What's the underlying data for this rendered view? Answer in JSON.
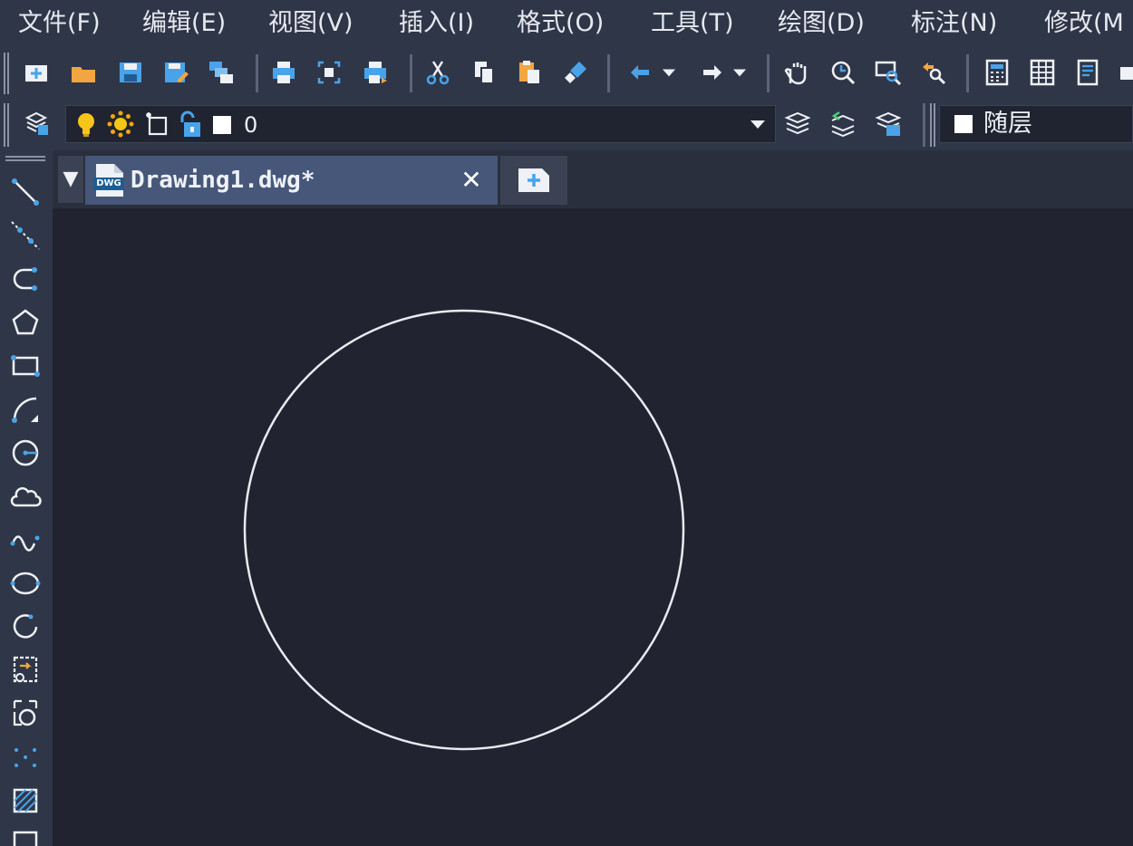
{
  "menu": [
    "文件(F)",
    "编辑(E)",
    "视图(V)",
    "插入(I)",
    "格式(O)",
    "工具(T)",
    "绘图(D)",
    "标注(N)",
    "修改(M"
  ],
  "layer": {
    "current": "0"
  },
  "color": {
    "current": "随层"
  },
  "document": {
    "tab_title": "Drawing1.dwg*",
    "tab_icon_text": "DWG",
    "collapse_glyph": "▼",
    "close_glyph": "✕"
  },
  "colors": {
    "background": "#212430",
    "chrome": "#2f3648",
    "accent": "#4aa3e8",
    "circle": "#e8ebf0"
  },
  "icons": {
    "toolbar1": [
      "new-icon",
      "open-icon",
      "save-icon",
      "save-as-icon",
      "multi-window-icon",
      "print-icon",
      "plot-preview-icon",
      "publish-icon",
      "cut-icon",
      "copy-icon",
      "paste-icon",
      "match-properties-icon",
      "undo-icon",
      "redo-icon",
      "pan-icon",
      "zoom-realtime-icon",
      "zoom-window-icon",
      "zoom-previous-icon",
      "calculator-icon",
      "table-icon",
      "properties-icon"
    ],
    "toolbar2": [
      "layer-manager-icon",
      "bulb-icon",
      "sun-icon",
      "freeze-vp-icon",
      "unlock-icon",
      "layer-color-swatch",
      "make-current-icon",
      "layer-previous-icon",
      "layer-states-icon"
    ],
    "draw": [
      "line-icon",
      "construction-line-icon",
      "polyline-icon",
      "polygon-icon",
      "rectangle-icon",
      "arc-icon",
      "circle-icon",
      "revision-cloud-icon",
      "spline-icon",
      "ellipse-icon",
      "ellipse-arc-icon",
      "insert-block-icon",
      "make-block-icon",
      "point-icon",
      "hatch-icon"
    ]
  }
}
